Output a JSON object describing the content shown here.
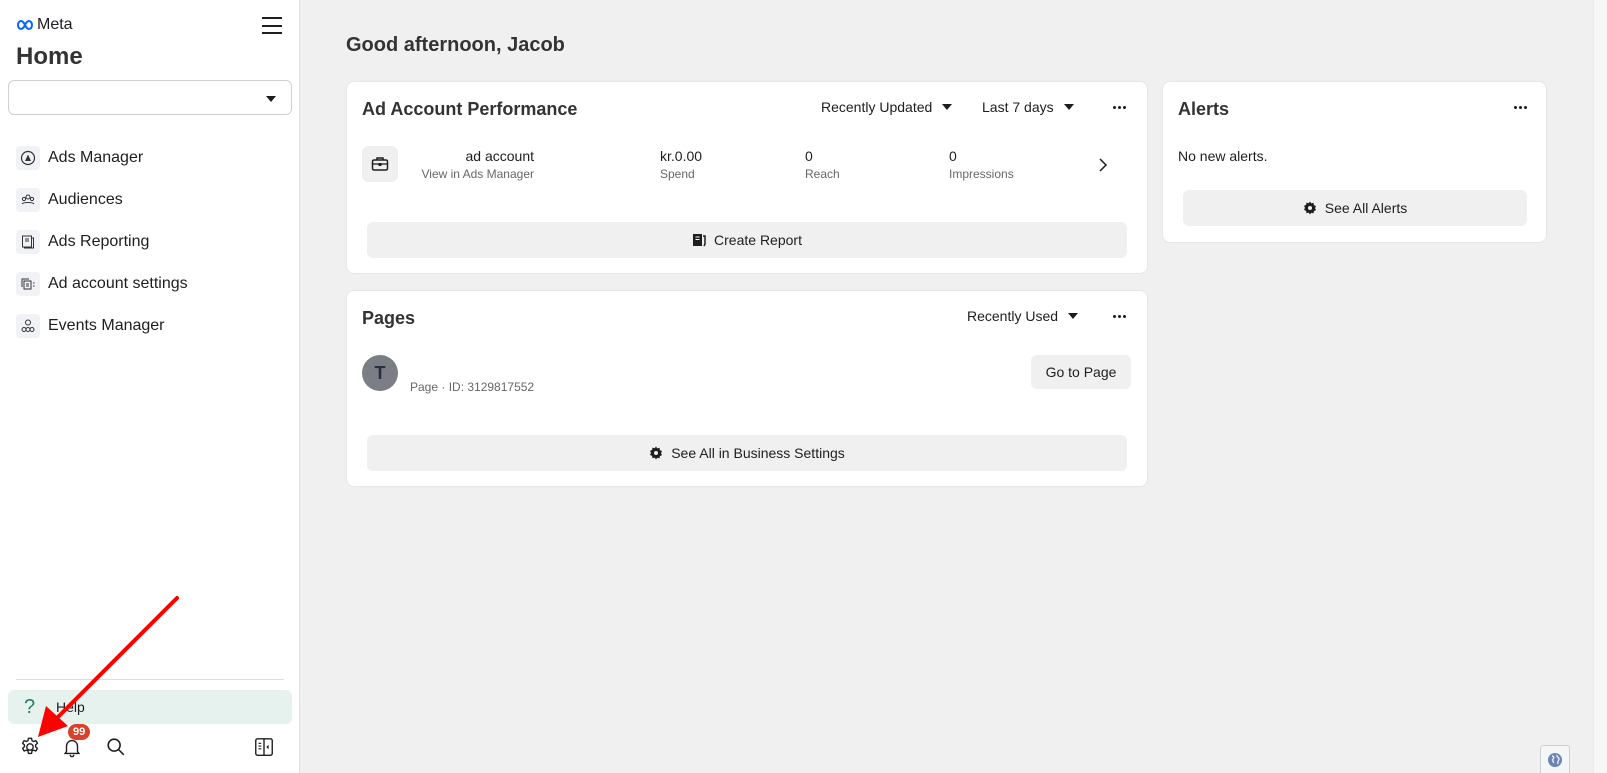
{
  "sidebar": {
    "brand": "Meta",
    "title": "Home",
    "account_selector": {
      "value": ""
    },
    "nav_items": [
      {
        "label": "Ads Manager",
        "icon": "ads-manager-icon"
      },
      {
        "label": "Audiences",
        "icon": "audiences-icon"
      },
      {
        "label": "Ads Reporting",
        "icon": "ads-reporting-icon"
      },
      {
        "label": "Ad account settings",
        "icon": "ad-account-settings-icon"
      },
      {
        "label": "Events Manager",
        "icon": "events-manager-icon"
      }
    ],
    "help_label": "Help",
    "notifications_badge": "99",
    "bottom_icons": [
      "gear-icon",
      "bell-icon",
      "search-icon",
      "panel-toggle-icon"
    ]
  },
  "main": {
    "greeting": "Good afternoon, Jacob",
    "ad_account_performance": {
      "title": "Ad Account Performance",
      "sort_dropdown": "Recently Updated",
      "range_dropdown": "Last 7 days",
      "account": {
        "name": "ad account",
        "link": "View in Ads Manager"
      },
      "stats": [
        {
          "value": "kr.0.00",
          "label": "Spend"
        },
        {
          "value": "0",
          "label": "Reach"
        },
        {
          "value": "0",
          "label": "Impressions"
        }
      ],
      "create_report_label": "Create Report"
    },
    "pages": {
      "title": "Pages",
      "sort_dropdown": "Recently Used",
      "page": {
        "avatar_letter": "T",
        "meta": "Page · ID: 3129817552"
      },
      "go_to_page_label": "Go to Page",
      "see_all_label": "See All in Business Settings"
    },
    "alerts": {
      "title": "Alerts",
      "message": "No new alerts.",
      "see_all_label": "See All Alerts"
    }
  },
  "annotation": {
    "color": "#ff0000",
    "points_to": "settings-gear-button"
  }
}
